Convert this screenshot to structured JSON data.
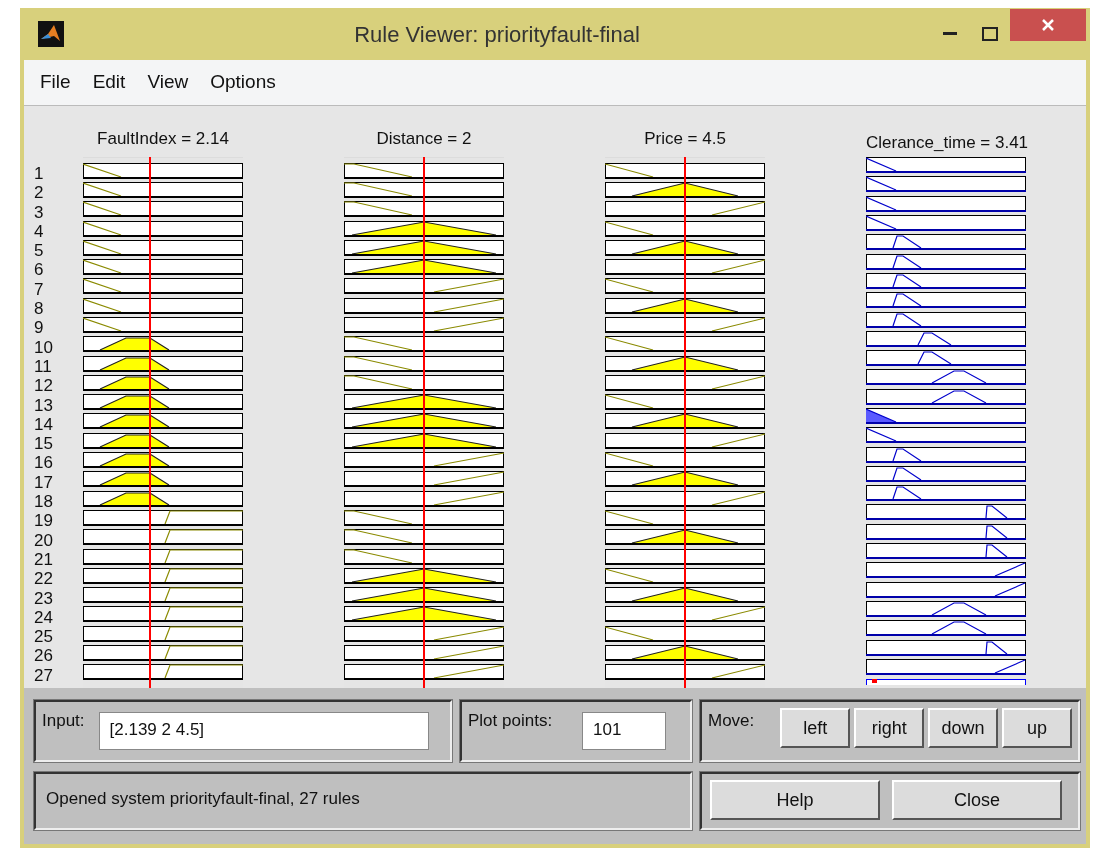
{
  "window": {
    "title": "Rule Viewer: priorityfault-final"
  },
  "menu": [
    "File",
    "Edit",
    "View",
    "Options"
  ],
  "columns": [
    {
      "label": "FaultIndex = 2.14",
      "kind": "input",
      "level": 0.42
    },
    {
      "label": "Distance = 2",
      "kind": "input",
      "level": 0.5
    },
    {
      "label": "Price = 4.5",
      "kind": "input",
      "level": 0.5
    },
    {
      "label": "Clerance_time = 3.41",
      "kind": "output"
    }
  ],
  "rules": [
    {
      "number": "1",
      "cells": [
        {
          "kind": "low",
          "fired": false
        },
        {
          "kind": "low",
          "fired": false
        },
        {
          "kind": "low",
          "fired": false
        },
        {
          "kind": "out1",
          "fired": false
        }
      ]
    },
    {
      "number": "2",
      "cells": [
        {
          "kind": "low",
          "fired": false
        },
        {
          "kind": "low",
          "fired": false
        },
        {
          "kind": "mid",
          "fired": true
        },
        {
          "kind": "out1",
          "fired": false
        }
      ]
    },
    {
      "number": "3",
      "cells": [
        {
          "kind": "low",
          "fired": false
        },
        {
          "kind": "low",
          "fired": false
        },
        {
          "kind": "high",
          "fired": false
        },
        {
          "kind": "out1",
          "fired": false
        }
      ]
    },
    {
      "number": "4",
      "cells": [
        {
          "kind": "low",
          "fired": false
        },
        {
          "kind": "mid",
          "fired": true
        },
        {
          "kind": "low",
          "fired": false
        },
        {
          "kind": "out1",
          "fired": false
        }
      ]
    },
    {
      "number": "5",
      "cells": [
        {
          "kind": "low",
          "fired": false
        },
        {
          "kind": "mid",
          "fired": true
        },
        {
          "kind": "mid",
          "fired": true
        },
        {
          "kind": "out2",
          "fired": false
        }
      ]
    },
    {
      "number": "6",
      "cells": [
        {
          "kind": "low",
          "fired": false
        },
        {
          "kind": "mid",
          "fired": true
        },
        {
          "kind": "high",
          "fired": false
        },
        {
          "kind": "out2",
          "fired": false
        }
      ]
    },
    {
      "number": "7",
      "cells": [
        {
          "kind": "low",
          "fired": false
        },
        {
          "kind": "high",
          "fired": false
        },
        {
          "kind": "low",
          "fired": false
        },
        {
          "kind": "out2",
          "fired": false
        }
      ]
    },
    {
      "number": "8",
      "cells": [
        {
          "kind": "low",
          "fired": false
        },
        {
          "kind": "high",
          "fired": false
        },
        {
          "kind": "mid",
          "fired": true
        },
        {
          "kind": "out2",
          "fired": false
        }
      ]
    },
    {
      "number": "9",
      "cells": [
        {
          "kind": "low",
          "fired": false
        },
        {
          "kind": "high",
          "fired": false
        },
        {
          "kind": "high",
          "fired": false
        },
        {
          "kind": "out2",
          "fired": false
        }
      ]
    },
    {
      "number": "10",
      "cells": [
        {
          "kind": "mid",
          "fired": true
        },
        {
          "kind": "low",
          "fired": false
        },
        {
          "kind": "low",
          "fired": false
        },
        {
          "kind": "out3",
          "fired": false
        }
      ]
    },
    {
      "number": "11",
      "cells": [
        {
          "kind": "mid",
          "fired": true
        },
        {
          "kind": "low",
          "fired": false
        },
        {
          "kind": "mid",
          "fired": true
        },
        {
          "kind": "out3",
          "fired": false
        }
      ]
    },
    {
      "number": "12",
      "cells": [
        {
          "kind": "mid",
          "fired": true
        },
        {
          "kind": "low",
          "fired": false
        },
        {
          "kind": "high",
          "fired": false
        },
        {
          "kind": "out4",
          "fired": false
        }
      ]
    },
    {
      "number": "13",
      "cells": [
        {
          "kind": "mid",
          "fired": true
        },
        {
          "kind": "mid",
          "fired": true
        },
        {
          "kind": "low",
          "fired": false
        },
        {
          "kind": "out4",
          "fired": false
        }
      ]
    },
    {
      "number": "14",
      "cells": [
        {
          "kind": "mid",
          "fired": true
        },
        {
          "kind": "mid",
          "fired": true
        },
        {
          "kind": "mid",
          "fired": true
        },
        {
          "kind": "out1",
          "fired": true
        }
      ]
    },
    {
      "number": "15",
      "cells": [
        {
          "kind": "mid",
          "fired": true
        },
        {
          "kind": "mid",
          "fired": true
        },
        {
          "kind": "high",
          "fired": false
        },
        {
          "kind": "out1",
          "fired": false
        }
      ]
    },
    {
      "number": "16",
      "cells": [
        {
          "kind": "mid",
          "fired": true
        },
        {
          "kind": "high",
          "fired": false
        },
        {
          "kind": "low",
          "fired": false
        },
        {
          "kind": "out2",
          "fired": false
        }
      ]
    },
    {
      "number": "17",
      "cells": [
        {
          "kind": "mid",
          "fired": true
        },
        {
          "kind": "high",
          "fired": false
        },
        {
          "kind": "mid",
          "fired": true
        },
        {
          "kind": "out2",
          "fired": false
        }
      ]
    },
    {
      "number": "18",
      "cells": [
        {
          "kind": "mid",
          "fired": true
        },
        {
          "kind": "high",
          "fired": false
        },
        {
          "kind": "high",
          "fired": false
        },
        {
          "kind": "out2",
          "fired": false
        }
      ]
    },
    {
      "number": "19",
      "cells": [
        {
          "kind": "high",
          "fired": false
        },
        {
          "kind": "low",
          "fired": false
        },
        {
          "kind": "low",
          "fired": false
        },
        {
          "kind": "out5",
          "fired": false
        }
      ]
    },
    {
      "number": "20",
      "cells": [
        {
          "kind": "high",
          "fired": false
        },
        {
          "kind": "low",
          "fired": false
        },
        {
          "kind": "mid",
          "fired": true
        },
        {
          "kind": "out5",
          "fired": false
        }
      ]
    },
    {
      "number": "21",
      "cells": [
        {
          "kind": "high",
          "fired": false
        },
        {
          "kind": "low",
          "fired": false
        },
        {
          "kind": "none",
          "fired": false
        },
        {
          "kind": "out5",
          "fired": false
        }
      ]
    },
    {
      "number": "22",
      "cells": [
        {
          "kind": "high",
          "fired": false
        },
        {
          "kind": "mid",
          "fired": true
        },
        {
          "kind": "low",
          "fired": false
        },
        {
          "kind": "out6",
          "fired": false
        }
      ]
    },
    {
      "number": "23",
      "cells": [
        {
          "kind": "high",
          "fired": false
        },
        {
          "kind": "mid",
          "fired": true
        },
        {
          "kind": "mid",
          "fired": true
        },
        {
          "kind": "out6",
          "fired": false
        }
      ]
    },
    {
      "number": "24",
      "cells": [
        {
          "kind": "high",
          "fired": false
        },
        {
          "kind": "mid",
          "fired": true
        },
        {
          "kind": "high",
          "fired": false
        },
        {
          "kind": "out4",
          "fired": false
        }
      ]
    },
    {
      "number": "25",
      "cells": [
        {
          "kind": "high",
          "fired": false
        },
        {
          "kind": "high",
          "fired": false
        },
        {
          "kind": "low",
          "fired": false
        },
        {
          "kind": "out4",
          "fired": false
        }
      ]
    },
    {
      "number": "26",
      "cells": [
        {
          "kind": "high",
          "fired": false
        },
        {
          "kind": "high",
          "fired": false
        },
        {
          "kind": "mid",
          "fired": true
        },
        {
          "kind": "out5",
          "fired": false
        }
      ]
    },
    {
      "number": "27",
      "cells": [
        {
          "kind": "high",
          "fired": false
        },
        {
          "kind": "high",
          "fired": false
        },
        {
          "kind": "high",
          "fired": false
        },
        {
          "kind": "out6",
          "fired": false
        }
      ]
    }
  ],
  "input": {
    "label": "Input:",
    "value": "[2.139 2 4.5]"
  },
  "plot_points": {
    "label": "Plot points:",
    "value": "101"
  },
  "move": {
    "label": "Move:",
    "buttons": [
      "left",
      "right",
      "down",
      "up"
    ]
  },
  "status": "Opened system priorityfault-final, 27 rules",
  "buttons": [
    "Help",
    "Close"
  ]
}
